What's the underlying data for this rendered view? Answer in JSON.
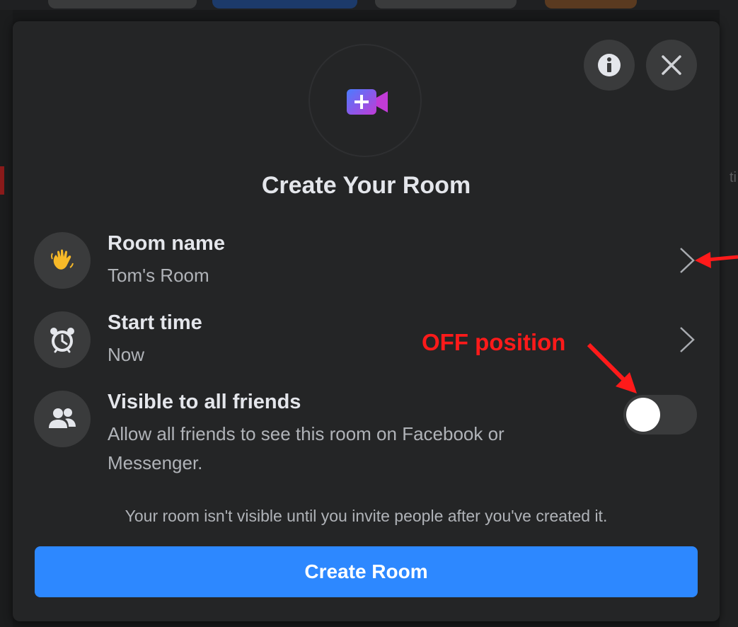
{
  "dialog": {
    "title": "Create Your Room",
    "info_icon": "info-icon",
    "close_icon": "close-icon",
    "hero_icon": "video-camera-plus-icon"
  },
  "rows": [
    {
      "title": "Room name",
      "subtitle": "Tom's Room",
      "icon": "waving-hand-icon"
    },
    {
      "title": "Start time",
      "subtitle": "Now",
      "icon": "alarm-clock-icon"
    },
    {
      "title": "Visible to all friends",
      "subtitle": "Allow all friends to see this room on Facebook or Messenger.",
      "icon": "friends-icon",
      "toggle_on": false
    }
  ],
  "note": "Your room isn't visible until you invite people after you've created it.",
  "create_button": "Create Room",
  "annotation": {
    "label": "OFF position",
    "color": "#ff1a1a"
  },
  "colors": {
    "accent": "#2d88ff",
    "dialog_bg": "#242526",
    "gradient_start": "#4a7cff",
    "gradient_end": "#c13bd6"
  }
}
